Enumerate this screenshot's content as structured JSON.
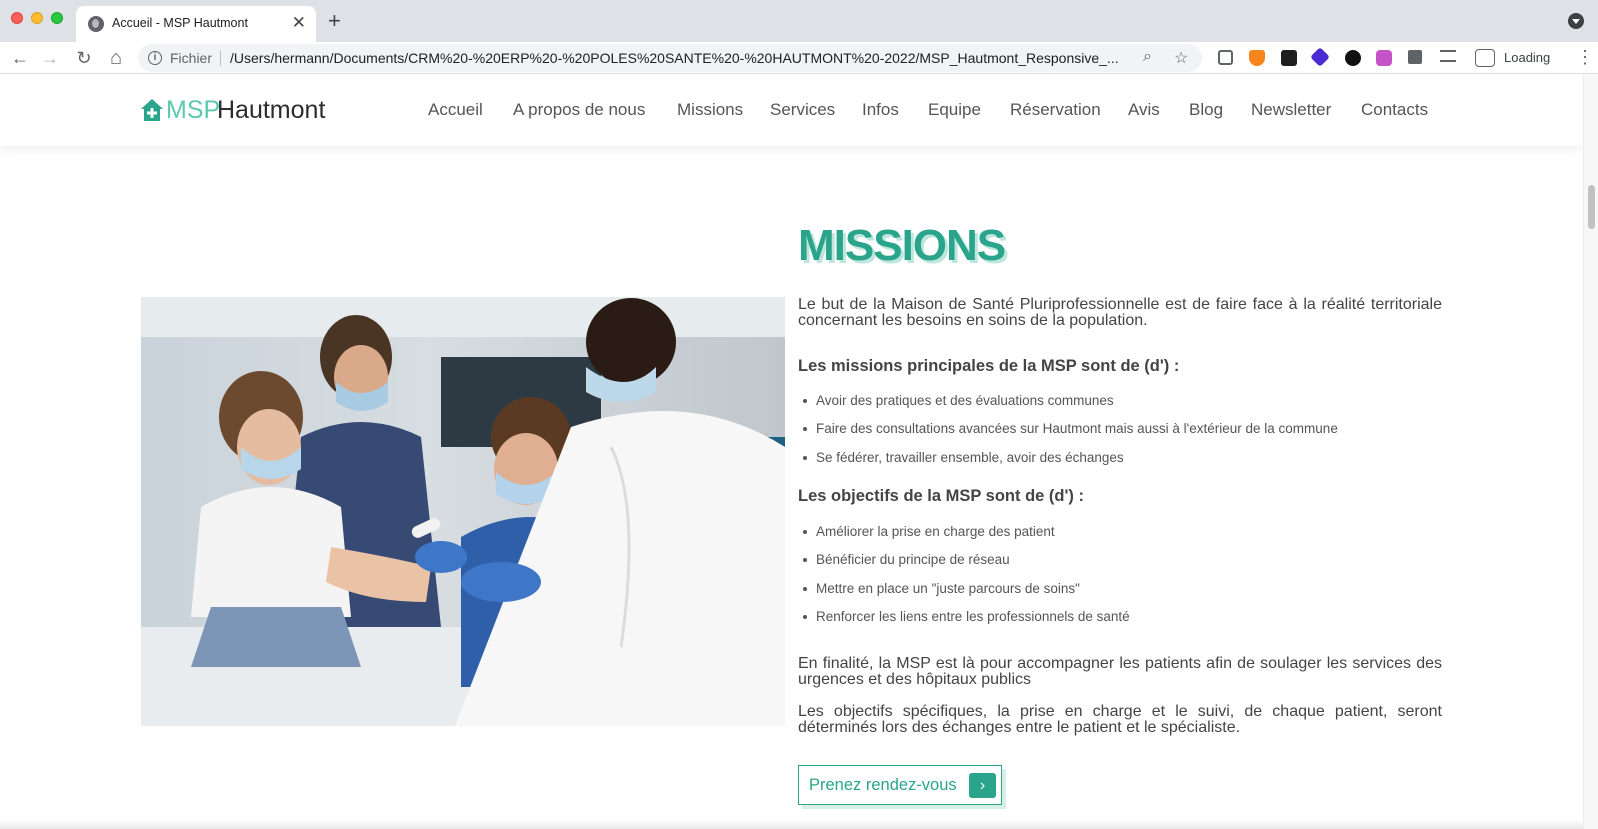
{
  "browser": {
    "tab_title": "Accueil - MSP Hautmont",
    "tab_close": "✕",
    "new_tab": "+",
    "scheme_label": "Fichier",
    "url": "/Users/hermann/Documents/CRM%20-%20ERP%20-%20POLES%20SANTE%20-%20HAUTMONT%20-2022/MSP_Hautmont_Responsive_...",
    "status_text": "Loading",
    "nav": {
      "back": "←",
      "forward": "→",
      "reload": "↻",
      "home": "⌂"
    },
    "icons": [
      "zoom-icon",
      "star-icon",
      "extension-cube-icon",
      "metamask-fox-icon",
      "binance-icon",
      "diamond-icon",
      "s-logo-icon",
      "hexagon-icon",
      "puzzle-icon",
      "media-queue-icon",
      "profile-icon",
      "menu-kebab-icon"
    ]
  },
  "site": {
    "logo_msp": "MSP",
    "logo_name": "Hautmont",
    "menu": [
      "Accueil",
      "A propos de nous",
      "Missions",
      "Services",
      "Infos",
      "Equipe",
      "Réservation",
      "Avis",
      "Blog",
      "Newsletter",
      "Contacts"
    ]
  },
  "missions": {
    "title": "MISSIONS",
    "intro": "Le but de la Maison de Santé Pluriprofessionnelle est de faire face à la réalité territoriale concernant les besoins en soins de la population.",
    "principal_heading": "Les missions principales de la MSP sont de (d') :",
    "principal_items": [
      "Avoir des pratiques et des évaluations communes",
      "Faire des consultations avancées sur Hautmont mais aussi à l'extérieur de la commune",
      "Se fédérer, travailler ensemble, avoir des échanges"
    ],
    "objectives_heading": "Les objectifs de la MSP sont de (d') :",
    "objectives_items": [
      "Améliorer la prise en charge des patient",
      "Bénéficier du principe de réseau",
      "Mettre en place un \"juste parcours de soins\"",
      "Renforcer les liens entre les professionnels de santé"
    ],
    "conclusion": "En finalité, la MSP est là pour accompagner les patients afin de soulager les services des urgences et des hôpitaux publics",
    "specific": "Les objectifs spécifiques, la prise en charge et le suivi, de chaque patient, seront déterminés lors des échanges entre le patient et le spécialiste.",
    "cta_label": "Prenez rendez-vous",
    "cta_arrow": "›"
  },
  "colors": {
    "accent": "#2aa58c",
    "logo_light": "#5cc8b0",
    "tab_bar": "#dee1e6"
  }
}
